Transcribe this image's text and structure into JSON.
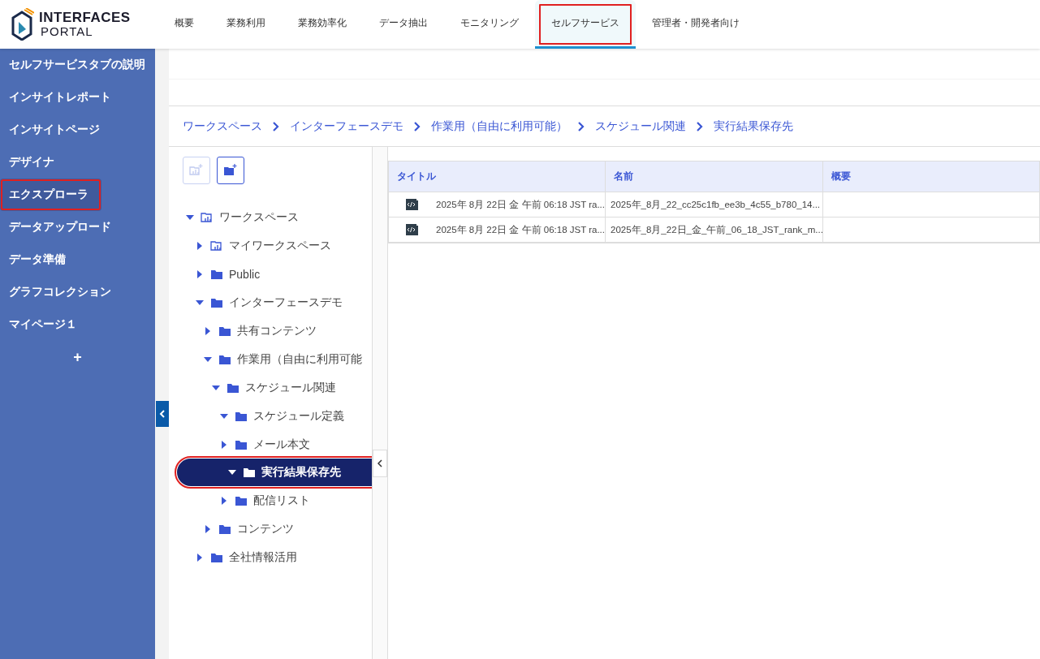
{
  "logo": {
    "line1": "INTERFACES",
    "line2": "PORTAL"
  },
  "nav_tabs": [
    {
      "label": "概要",
      "selected": false,
      "highlighted": false
    },
    {
      "label": "業務利用",
      "selected": false,
      "highlighted": false
    },
    {
      "label": "業務効率化",
      "selected": false,
      "highlighted": false
    },
    {
      "label": "データ抽出",
      "selected": false,
      "highlighted": false
    },
    {
      "label": "モニタリング",
      "selected": false,
      "highlighted": false
    },
    {
      "label": "セルフサービス",
      "selected": true,
      "highlighted": true
    },
    {
      "label": "管理者・開発者向け",
      "selected": false,
      "highlighted": false
    }
  ],
  "sidebar": {
    "items": [
      {
        "label": "セルフサービスタブの説明",
        "selected": false,
        "highlighted": false
      },
      {
        "label": "インサイトレポート",
        "selected": false,
        "highlighted": false
      },
      {
        "label": "インサイトページ",
        "selected": false,
        "highlighted": false
      },
      {
        "label": "デザイナ",
        "selected": false,
        "highlighted": false
      },
      {
        "label": "エクスプローラ",
        "selected": true,
        "highlighted": true
      },
      {
        "label": "データアップロード",
        "selected": false,
        "highlighted": false
      },
      {
        "label": "データ準備",
        "selected": false,
        "highlighted": false
      },
      {
        "label": "グラフコレクション",
        "selected": false,
        "highlighted": false
      },
      {
        "label": "マイページ１",
        "selected": false,
        "highlighted": false
      }
    ],
    "add_label": "+"
  },
  "breadcrumb": [
    "ワークスペース",
    "インターフェースデモ",
    "作業用（自由に利用可能）",
    "スケジュール関連",
    "実行結果保存先"
  ],
  "toolbar": [
    {
      "kind": "workspace",
      "disabled": true
    },
    {
      "kind": "folder",
      "disabled": false
    }
  ],
  "tree": [
    {
      "label": "ワークスペース",
      "kind": "workspace",
      "expanded": true,
      "selected": false,
      "highlighted": false,
      "children": [
        {
          "label": "マイワークスペース",
          "kind": "workspace",
          "expanded": false,
          "selected": false,
          "highlighted": false
        },
        {
          "label": "Public",
          "kind": "folder",
          "expanded": false,
          "selected": false,
          "highlighted": false
        },
        {
          "label": "インターフェースデモ",
          "kind": "folder",
          "expanded": true,
          "selected": false,
          "highlighted": false,
          "children": [
            {
              "label": "共有コンテンツ",
              "kind": "folder",
              "expanded": false,
              "selected": false,
              "highlighted": false
            },
            {
              "label": "作業用（自由に利用可能",
              "kind": "folder",
              "expanded": true,
              "selected": false,
              "highlighted": false,
              "children": [
                {
                  "label": "スケジュール関連",
                  "kind": "folder",
                  "expanded": true,
                  "selected": false,
                  "highlighted": false,
                  "children": [
                    {
                      "label": "スケジュール定義",
                      "kind": "folder",
                      "expanded": true,
                      "selected": false,
                      "highlighted": false
                    },
                    {
                      "label": "メール本文",
                      "kind": "folder",
                      "expanded": false,
                      "selected": false,
                      "highlighted": false
                    },
                    {
                      "label": "実行結果保存先",
                      "kind": "folder",
                      "expanded": true,
                      "selected": true,
                      "highlighted": true
                    },
                    {
                      "label": "配信リスト",
                      "kind": "folder",
                      "expanded": false,
                      "selected": false,
                      "highlighted": false
                    }
                  ]
                }
              ]
            },
            {
              "label": "コンテンツ",
              "kind": "folder",
              "expanded": false,
              "selected": false,
              "highlighted": false
            }
          ]
        },
        {
          "label": "全社情報活用",
          "kind": "folder",
          "expanded": false,
          "selected": false,
          "highlighted": false
        }
      ]
    }
  ],
  "table": {
    "columns": [
      "タイトル",
      "名前",
      "概要"
    ],
    "rows": [
      {
        "title": "2025年 8月 22日 金 午前 06:18 JST ra...",
        "name": "2025年_8月_22_cc25c1fb_ee3b_4c55_b780_14..."
      },
      {
        "title": "2025年 8月 22日 金 午前 06:18 JST ra...",
        "name": "2025年_8月_22日_金_午前_06_18_JST_rank_m..."
      }
    ]
  }
}
